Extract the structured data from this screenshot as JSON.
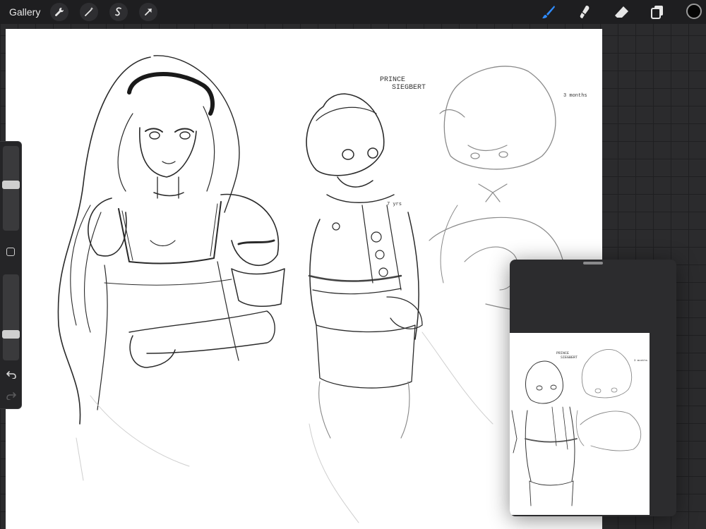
{
  "toolbar": {
    "gallery_label": "Gallery",
    "left_tools": [
      "wrench-icon",
      "magic-wand-icon",
      "selection-icon",
      "transform-arrow-icon"
    ],
    "right_tools": [
      "brush-icon",
      "smudge-icon",
      "eraser-icon",
      "layers-icon"
    ],
    "active_tool_color": "#2f8cff",
    "current_color": "#050505"
  },
  "sidebar": {
    "brush_size": 0.55,
    "opacity": 0.28
  },
  "canvas": {
    "annotations": {
      "name_line1": "PRINCE",
      "name_line2": "SIEGBERT",
      "age_note": "3 months",
      "small_note": "7 yrs"
    }
  },
  "reference": {
    "annotations": {
      "name_line1": "PRINCE",
      "name_line2": "SIEGBERT",
      "age_note": "3 months"
    }
  }
}
